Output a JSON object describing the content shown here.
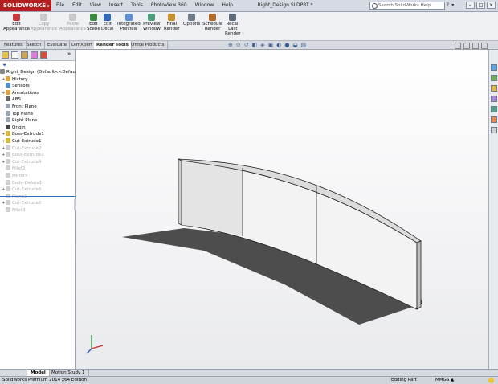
{
  "app": {
    "logo_text": "SOLIDWORKS"
  },
  "menu": [
    "File",
    "Edit",
    "View",
    "Insert",
    "Tools",
    "PhotoView 360",
    "Window",
    "Help"
  ],
  "document_title": "Right_Design.SLDPRT *",
  "search": {
    "placeholder": "Search SolidWorks Help"
  },
  "ribbon": [
    {
      "line1": "Edit",
      "line2": "Appearance",
      "enabled": true,
      "color": "#c63b3b"
    },
    {
      "line1": "Copy",
      "line2": "Appearance",
      "enabled": false,
      "color": "#c9c9c9"
    },
    {
      "line1": "Paste",
      "line2": "Appearance",
      "enabled": false,
      "color": "#c9c9c9"
    },
    {
      "line1": "Edit",
      "line2": "Scene",
      "enabled": true,
      "color": "#3b8a3f"
    },
    {
      "line1": "Edit",
      "line2": "Decal",
      "enabled": true,
      "color": "#2f6bb8"
    },
    {
      "line1": "Integrated",
      "line2": "Preview",
      "enabled": true,
      "color": "#5a8fd6"
    },
    {
      "line1": "Preview",
      "line2": "Window",
      "enabled": true,
      "color": "#4aa07a"
    },
    {
      "line1": "Final",
      "line2": "Render",
      "enabled": true,
      "color": "#c8902a"
    },
    {
      "line1": "Options",
      "line2": "",
      "enabled": true,
      "color": "#6f7c8c"
    },
    {
      "line1": "Schedule",
      "line2": "Render",
      "enabled": true,
      "color": "#b06a2a"
    },
    {
      "line1": "Recall",
      "line2": "Last",
      "line3": "Render",
      "enabled": true,
      "color": "#5a6b7c"
    }
  ],
  "command_tabs": [
    "Features",
    "Sketch",
    "Evaluate",
    "DimXpert",
    "Render Tools",
    "Office Products"
  ],
  "active_command_tab": "Render Tools",
  "feature_tree": [
    {
      "label": "Right_Design  (Default<<Defaul",
      "icon": "part-icon",
      "color": "#8a8a8a",
      "suppressed": false,
      "expand": ""
    },
    {
      "label": "History",
      "icon": "history-icon",
      "color": "#d9a441",
      "suppressed": false,
      "expand": "+"
    },
    {
      "label": "Sensors",
      "icon": "sensors-icon",
      "color": "#4c8fd6",
      "suppressed": false,
      "expand": ""
    },
    {
      "label": "Annotations",
      "icon": "annotations-icon",
      "color": "#d9a441",
      "suppressed": false,
      "expand": "+"
    },
    {
      "label": "ABS",
      "icon": "material-icon",
      "color": "#6a6a6a",
      "suppressed": false,
      "expand": ""
    },
    {
      "label": "Front Plane",
      "icon": "plane-icon",
      "color": "#9aa3b0",
      "suppressed": false,
      "expand": ""
    },
    {
      "label": "Top Plane",
      "icon": "plane-icon",
      "color": "#9aa3b0",
      "suppressed": false,
      "expand": ""
    },
    {
      "label": "Right Plane",
      "icon": "plane-icon",
      "color": "#9aa3b0",
      "suppressed": false,
      "expand": ""
    },
    {
      "label": "Origin",
      "icon": "origin-icon",
      "color": "#444444",
      "suppressed": false,
      "expand": ""
    },
    {
      "label": "Boss-Extrude1",
      "icon": "extrude-icon",
      "color": "#d9b63c",
      "suppressed": false,
      "expand": "+"
    },
    {
      "label": "Cut-Extrude1",
      "icon": "cut-icon",
      "color": "#d9b63c",
      "suppressed": false,
      "expand": "+"
    },
    {
      "label": "Cut-Extrude2",
      "icon": "cut-icon",
      "color": "#cfcfcf",
      "suppressed": true,
      "expand": "+"
    },
    {
      "label": "Boss-Extrude2",
      "icon": "extrude-icon",
      "color": "#cfcfcf",
      "suppressed": true,
      "expand": "+"
    },
    {
      "label": "Cut-Extrude4",
      "icon": "cut-icon",
      "color": "#cfcfcf",
      "suppressed": true,
      "expand": "+"
    },
    {
      "label": "Fillet2",
      "icon": "fillet-icon",
      "color": "#cfcfcf",
      "suppressed": true,
      "expand": ""
    },
    {
      "label": "Mirror4",
      "icon": "mirror-icon",
      "color": "#cfcfcf",
      "suppressed": true,
      "expand": ""
    },
    {
      "label": "Body-Delete1",
      "icon": "body-delete-icon",
      "color": "#cfcfcf",
      "suppressed": true,
      "expand": ""
    },
    {
      "label": "Cut-Extrude5",
      "icon": "cut-icon",
      "color": "#cfcfcf",
      "suppressed": true,
      "expand": "+"
    },
    {
      "label": "Plane1",
      "icon": "plane-icon",
      "color": "#cfcfcf",
      "suppressed": true,
      "expand": ""
    },
    {
      "label": "Cut-Extrude6",
      "icon": "cut-icon",
      "color": "#cfcfcf",
      "suppressed": true,
      "expand": "+"
    },
    {
      "label": "Fillet3",
      "icon": "fillet-icon",
      "color": "#cfcfcf",
      "suppressed": true,
      "expand": ""
    }
  ],
  "bottom_tabs": [
    "Model",
    "Motion Study 1"
  ],
  "active_bottom_tab": "Model",
  "status": {
    "edition": "SolidWorks Premium 2014 x64 Edition",
    "mode": "Editing Part",
    "units": "MMGS",
    "units_arrow": "▲"
  },
  "window_controls": [
    "–",
    "□",
    "×"
  ],
  "help_icons": [
    "?",
    "▾"
  ],
  "triad": {
    "x_label": "",
    "y_label": "",
    "z_label": ""
  }
}
